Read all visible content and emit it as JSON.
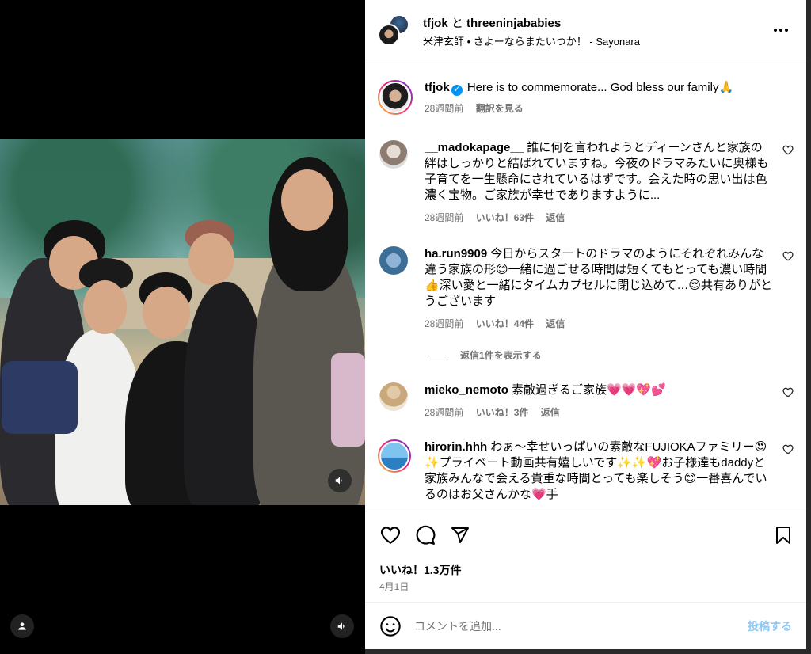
{
  "header": {
    "user1": "tfjok",
    "connector": "と",
    "user2": "threeninjababies",
    "audio": "米津玄師 • さよーならまたいつか！ - Sayonara"
  },
  "caption": {
    "username": "tfjok",
    "text": "Here is to commemorate... God bless our family🙏",
    "time": "28週間前",
    "translate": "翻訳を見る"
  },
  "comments": [
    {
      "username": "__madokapage__",
      "text": "誰に何を言われようとディーンさんと家族の絆はしっかりと結ばれていますね。今夜のドラマみたいに奥様も子育てを一生懸命にされているはずです。会えた時の思い出は色濃く宝物。ご家族が幸せでありますように...",
      "time": "28週間前",
      "likes": "いいね！63件",
      "reply": "返信"
    },
    {
      "username": "ha.run9909",
      "text": "今日からスタートのドラマのようにそれぞれみんな違う家族の形😊一緒に過ごせる時間は短くてもとっても濃い時間👍深い愛と一緒にタイムカプセルに閉じ込めて…😌共有ありがとうございます",
      "time": "28週間前",
      "likes": "いいね！44件",
      "reply": "返信",
      "view_replies": "返信1件を表示する"
    },
    {
      "username": "mieko_nemoto",
      "text": "素敵過ぎるご家族💗💗💖💕",
      "time": "28週間前",
      "likes": "いいね！3件",
      "reply": "返信"
    },
    {
      "username": "hirorin.hhh",
      "text": "わぁ〜幸せいっぱいの素敵なFUJIOKAファミリー😍✨プライベート動画共有嬉しいです✨✨💖お子様達もdaddyと家族みんなで会える貴重な時間とっても楽しそう😊一番喜んでいるのはお父さんかな💗手"
    }
  ],
  "footer": {
    "likes": "いいね！1.3万件",
    "date": "4月1日",
    "comment_placeholder": "コメントを追加...",
    "post_label": "投稿する"
  },
  "icons": {
    "like": "heart-icon",
    "comment": "comment-icon",
    "share": "share-icon",
    "save": "bookmark-icon",
    "more": "more-icon",
    "volume": "volume-icon",
    "user": "user-icon",
    "emoji": "emoji-icon"
  },
  "colors": {
    "accent": "#0095f6",
    "muted": "#737373",
    "post_disabled": "#8ec8f5"
  }
}
